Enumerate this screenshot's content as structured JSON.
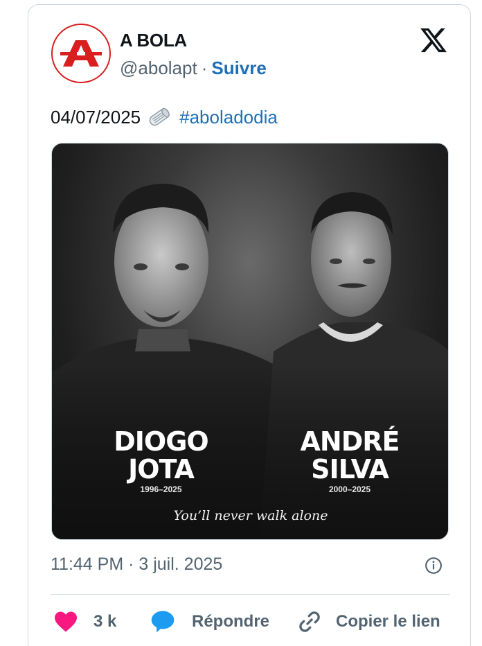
{
  "author": {
    "name": "A BOLA",
    "handle": "@abolapt",
    "separator": "·",
    "follow_label": "Suivre",
    "avatar_letter": "A",
    "brand_color": "#d81e1e"
  },
  "platform_icon": "x-logo-icon",
  "tweet": {
    "date_text": "04/07/2025",
    "emoji_icon": "rolled-newspaper-icon",
    "hashtag": "#aboladodia"
  },
  "media": {
    "players": [
      {
        "first": "DIOGO",
        "last": "JOTA",
        "years": "1996–2025"
      },
      {
        "first": "ANDRÉ",
        "last": "SILVA",
        "years": "2000–2025"
      }
    ],
    "motto": "You’ll never walk alone"
  },
  "meta": {
    "timestamp": "11:44 PM · 3 juil. 2025",
    "info_icon": "info-icon"
  },
  "actions": {
    "like_count": "3 k",
    "reply_label": "Répondre",
    "copy_label": "Copier le lien"
  },
  "colors": {
    "link": "#1d6fb8",
    "like": "#f91880",
    "reply": "#1d9bf0",
    "muted": "#536471"
  }
}
